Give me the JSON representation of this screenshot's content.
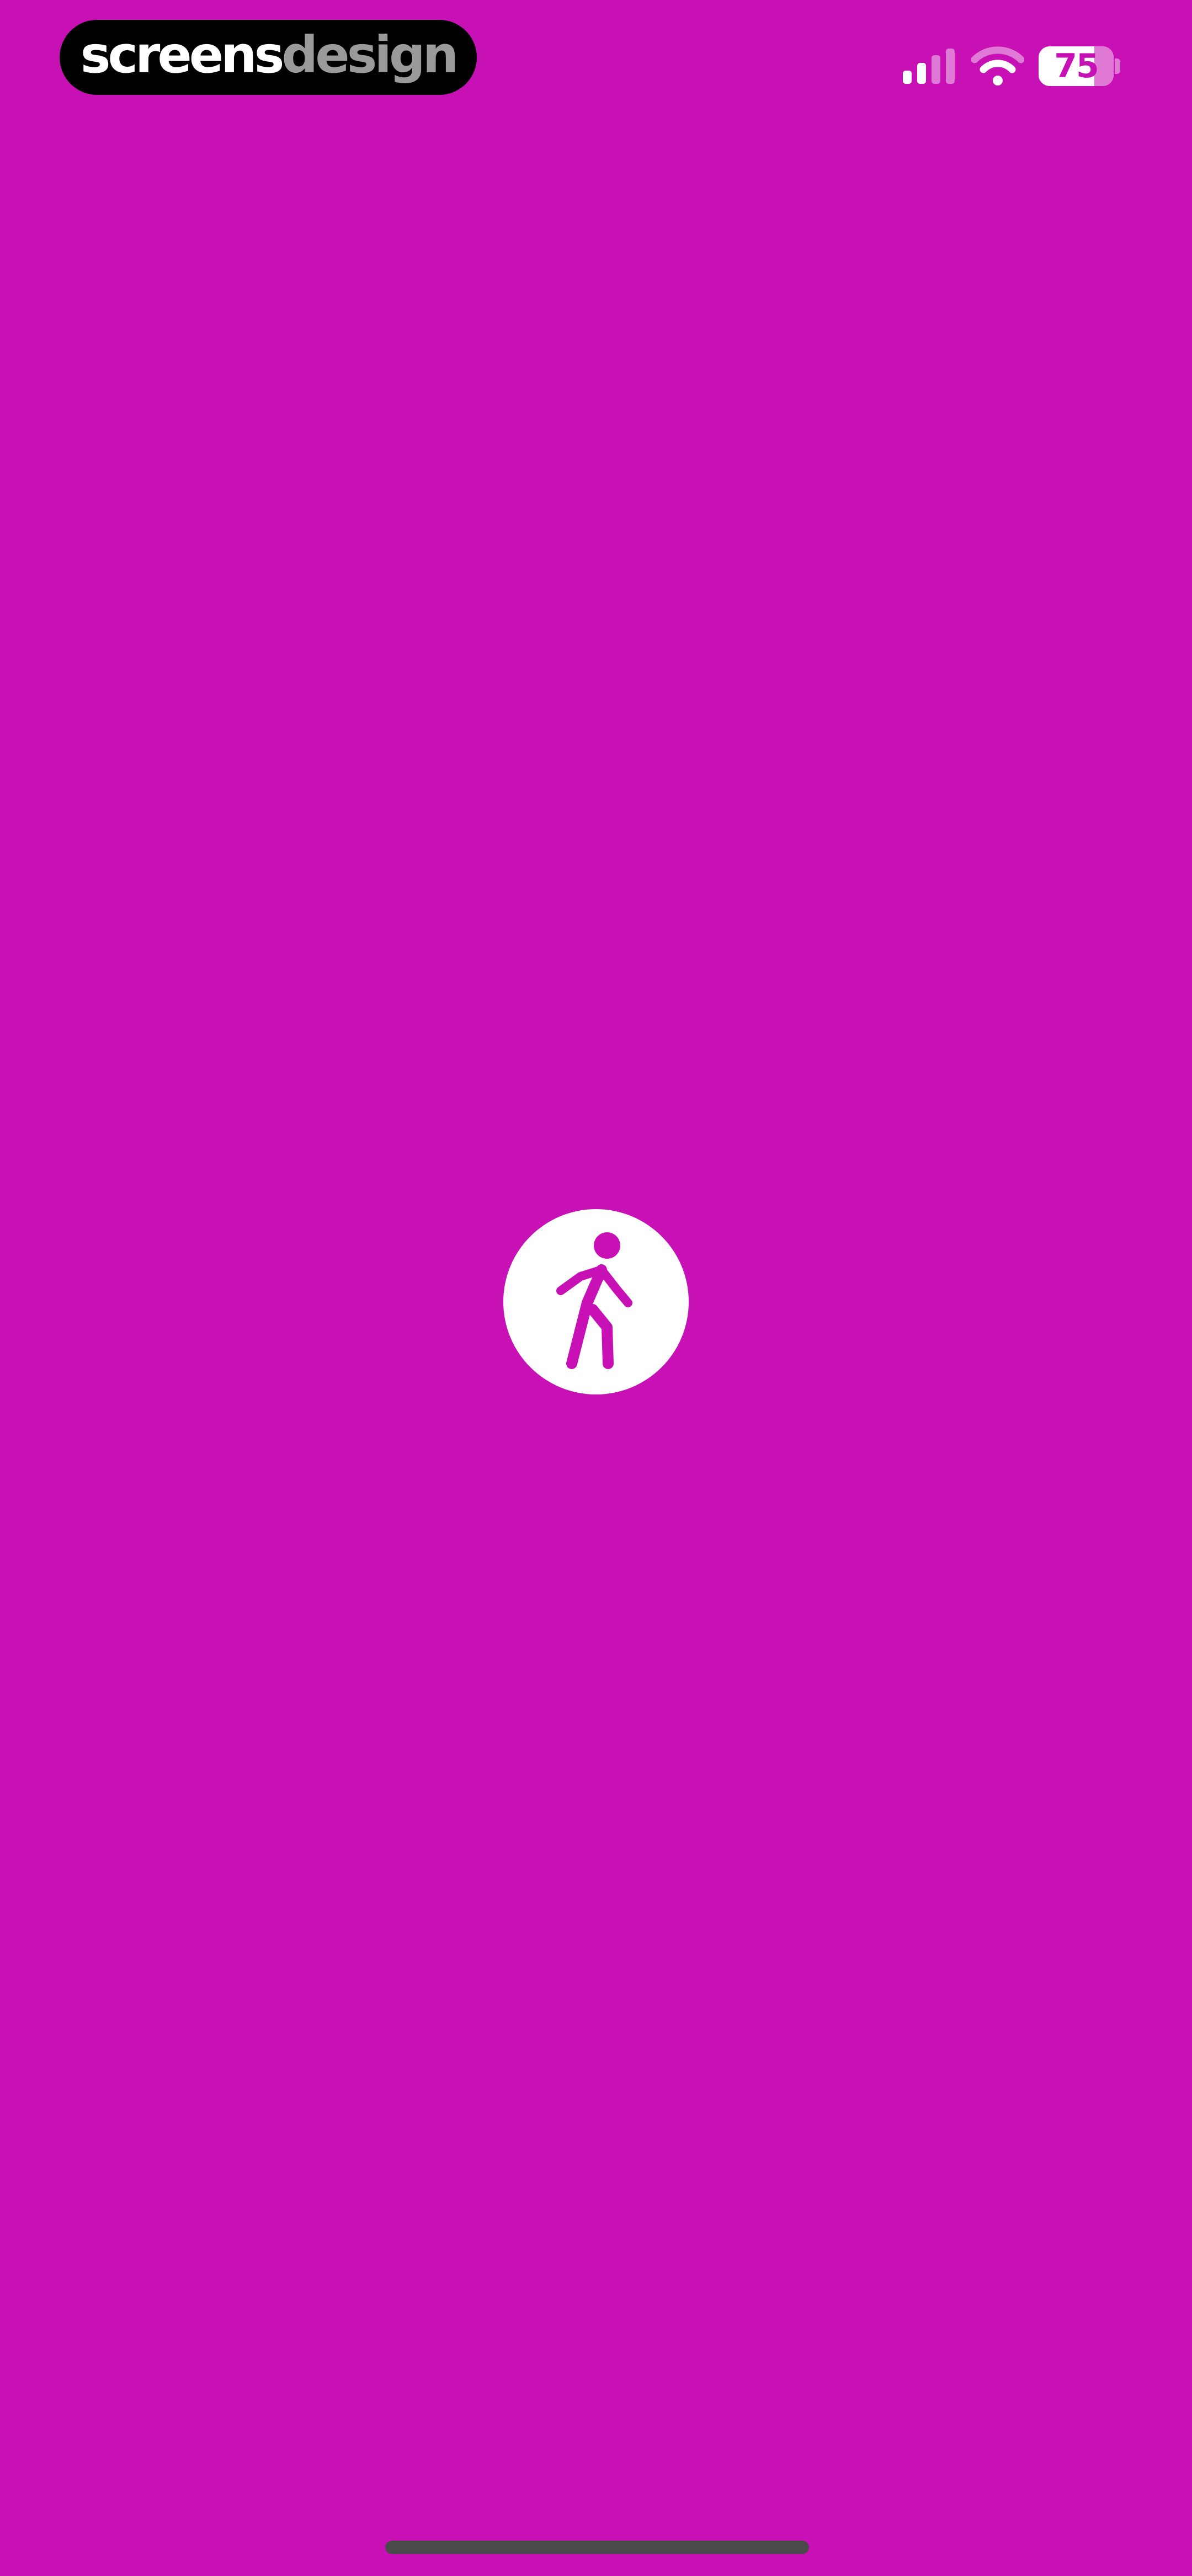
{
  "watermark": {
    "part_a": "screens",
    "part_b": "design"
  },
  "status_bar": {
    "battery_level": "75",
    "signal_bars_active": 2,
    "signal_bars_total": 4,
    "icons": [
      "cellular-signal-icon",
      "wifi-icon",
      "battery-icon"
    ]
  },
  "splash": {
    "icon": "walking-person-icon"
  },
  "colors": {
    "background": "#c711b4",
    "foreground": "#ffffff",
    "watermark_bg": "#000000",
    "watermark_secondary": "#9a9a9a"
  }
}
